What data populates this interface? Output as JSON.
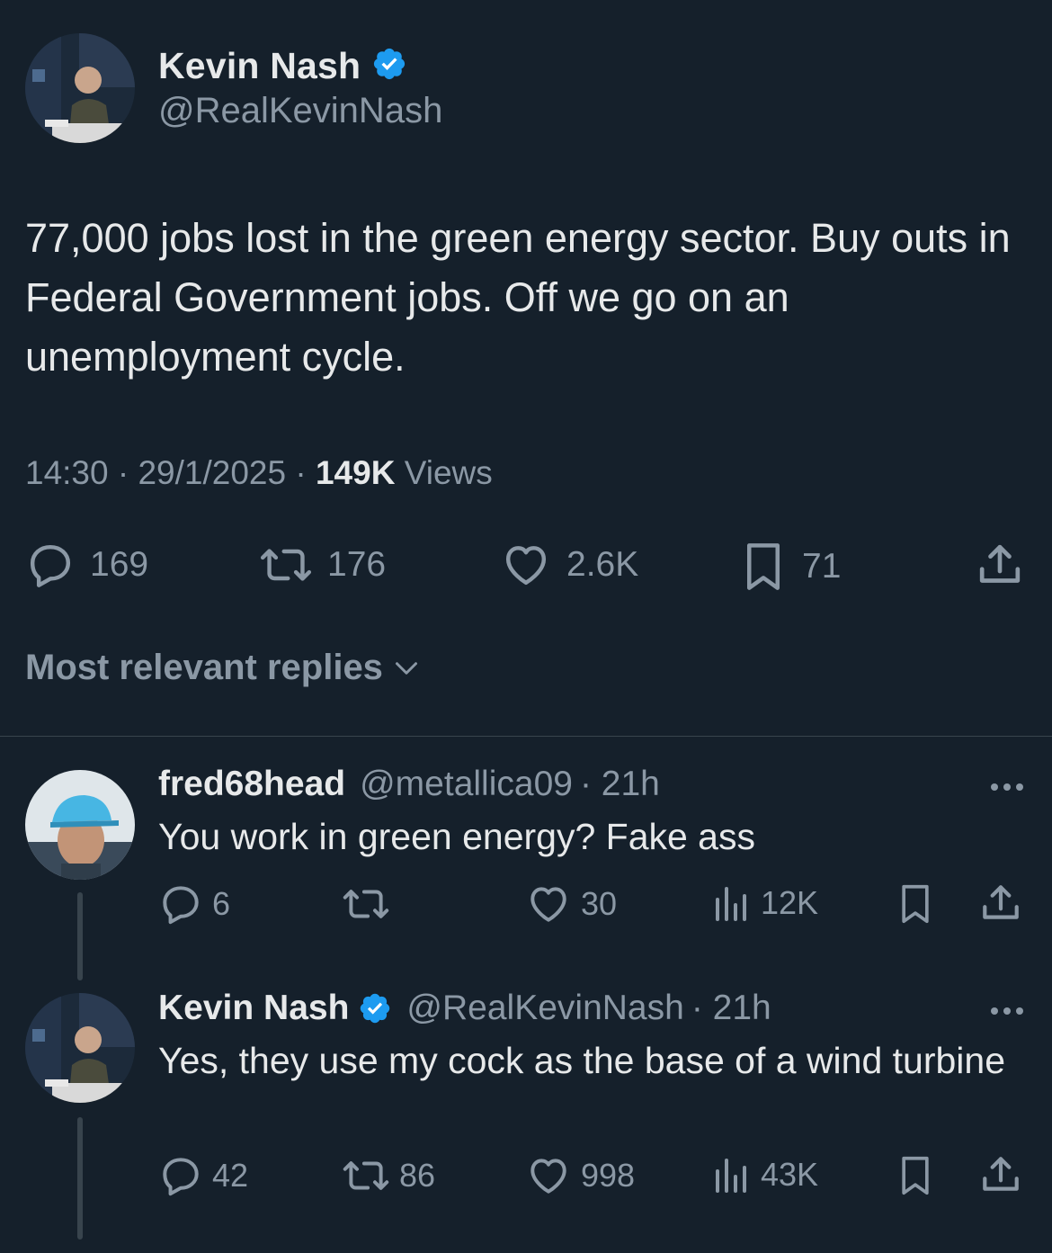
{
  "tweet": {
    "author_name": "Kevin Nash",
    "author_handle": "@RealKevinNash",
    "text": "77,000 jobs lost in the green energy sector. Buy outs in Federal Government jobs. Off we go on an unemployment cycle.",
    "time": "14:30",
    "date": "29/1/2025",
    "views_count": "149K",
    "views_label": "Views",
    "separator": "·",
    "actions": {
      "replies": "169",
      "reposts": "176",
      "likes": "2.6K",
      "bookmarks": "71"
    }
  },
  "sort": {
    "label": "Most relevant replies"
  },
  "replies": [
    {
      "author_name": "fred68head",
      "author_handle": "@metallica09",
      "time": "· 21h",
      "text": "You work in green energy? Fake ass",
      "replies": "6",
      "reposts": "",
      "likes": "30",
      "views": "12K"
    },
    {
      "author_name": "Kevin Nash",
      "author_handle": "@RealKevinNash",
      "time": "· 21h",
      "text": "Yes, they use my cock as the base of a wind turbine",
      "replies": "42",
      "reposts": "86",
      "likes": "998",
      "views": "43K"
    }
  ],
  "colors": {
    "background": "#15202b",
    "text": "#e7e9ea",
    "muted": "#8b98a5",
    "verified": "#1d9bf0",
    "divider": "#38444d"
  },
  "icons": [
    "reply-icon",
    "repost-icon",
    "like-icon",
    "bookmark-icon",
    "share-icon",
    "views-icon",
    "verified-badge-icon",
    "chevron-down-icon",
    "more-icon"
  ]
}
